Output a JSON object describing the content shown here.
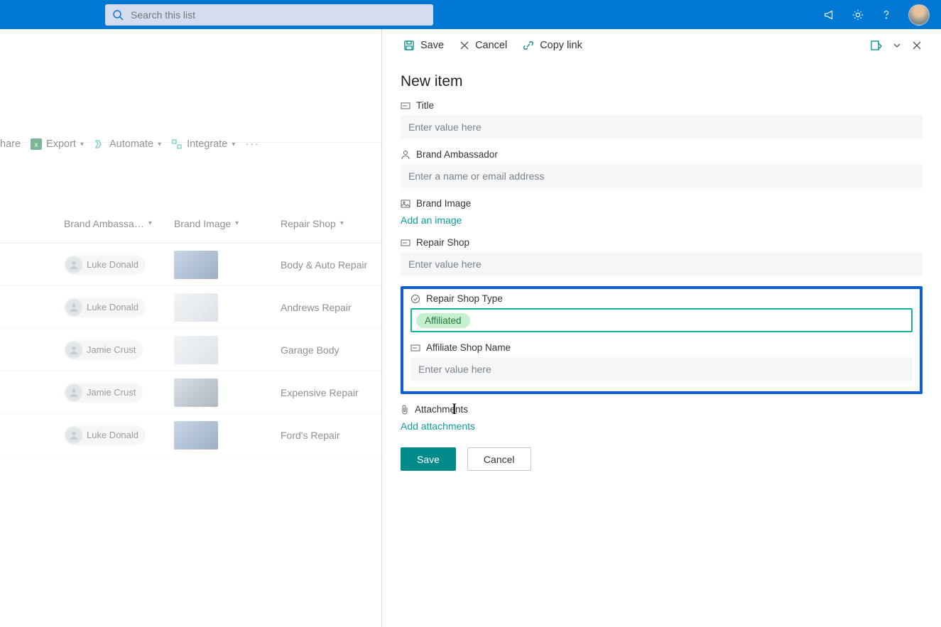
{
  "topbar": {
    "search_placeholder": "Search this list"
  },
  "cmdbar": {
    "share": "hare",
    "export": "Export",
    "automate": "Automate",
    "integrate": "Integrate"
  },
  "list": {
    "columns": {
      "ambassador": "Brand Ambassa…",
      "image": "Brand Image",
      "repair": "Repair Shop"
    },
    "rows": [
      {
        "person": "Luke Donald",
        "shop": "Body & Auto Repair"
      },
      {
        "person": "Luke Donald",
        "shop": "Andrews Repair"
      },
      {
        "person": "Jamie Crust",
        "shop": "Garage Body"
      },
      {
        "person": "Jamie Crust",
        "shop": "Expensive Repair"
      },
      {
        "person": "Luke Donald",
        "shop": "Ford's Repair"
      }
    ]
  },
  "panel": {
    "top": {
      "save": "Save",
      "cancel": "Cancel",
      "copy": "Copy link"
    },
    "title": "New item",
    "fields": {
      "title_label": "Title",
      "title_ph": "Enter value here",
      "ambassador_label": "Brand Ambassador",
      "ambassador_ph": "Enter a name or email address",
      "image_label": "Brand Image",
      "image_link": "Add an image",
      "repair_label": "Repair Shop",
      "repair_ph": "Enter value here",
      "type_label": "Repair Shop Type",
      "type_value": "Affiliated",
      "aff_name_label": "Affiliate Shop Name",
      "aff_name_ph": "Enter value here",
      "attach_label": "Attachments",
      "attach_link": "Add attachments"
    },
    "buttons": {
      "save": "Save",
      "cancel": "Cancel"
    }
  }
}
